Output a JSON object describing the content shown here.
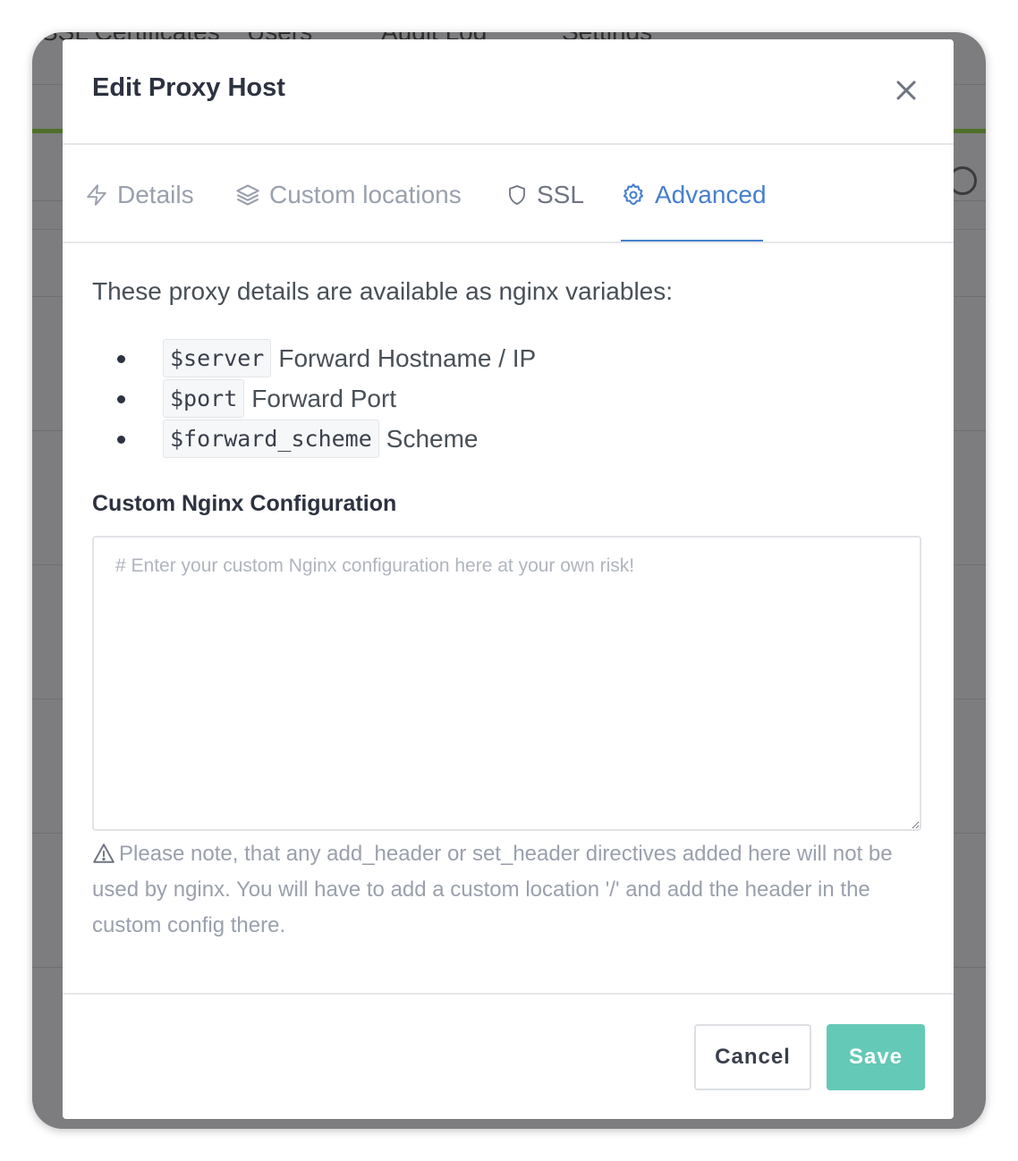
{
  "background": {
    "nav_items": [
      "SSL Certificates",
      "Users",
      "Audit Log",
      "Settings"
    ]
  },
  "modal": {
    "title": "Edit Proxy Host",
    "close_icon": "close-icon",
    "tabs": [
      {
        "label": "Details",
        "icon": "lightning-icon",
        "active": false
      },
      {
        "label": "Custom locations",
        "icon": "layers-icon",
        "active": false
      },
      {
        "label": "SSL",
        "icon": "shield-icon",
        "active": false
      },
      {
        "label": "Advanced",
        "icon": "gear-icon",
        "active": true
      }
    ],
    "intro": "These proxy details are available as nginx variables:",
    "variables": [
      {
        "code": "$server",
        "desc": "Forward Hostname / IP"
      },
      {
        "code": "$port",
        "desc": "Forward Port"
      },
      {
        "code": "$forward_scheme",
        "desc": "Scheme"
      }
    ],
    "config_label": "Custom Nginx Configuration",
    "config_value": "",
    "config_placeholder": "# Enter your custom Nginx configuration here at your own risk!",
    "note": "Please note, that any add_header or set_header directives added here will not be used by nginx. You will have to add a custom location '/' and add the header in the custom config there.",
    "buttons": {
      "cancel": "Cancel",
      "save": "Save"
    }
  },
  "colors": {
    "accent": "#467fcf",
    "save_button": "#64c9b6",
    "muted_text": "#9aa0ac"
  }
}
